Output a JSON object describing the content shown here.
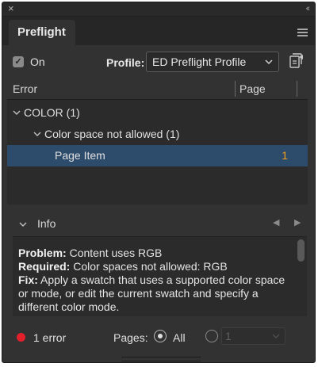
{
  "titlebar": {
    "close_icon": "×",
    "collapse_icon": "‹‹"
  },
  "tab": {
    "label": "Preflight"
  },
  "controls": {
    "on_label": "On",
    "on_checked": true,
    "profile_label": "Profile:",
    "profile_value": "ED Preflight Profile"
  },
  "columns": {
    "error": "Error",
    "page": "Page"
  },
  "tree": {
    "group": {
      "label": "COLOR (1)"
    },
    "subgroup": {
      "label": "Color space not allowed (1)"
    },
    "item": {
      "label": "Page Item",
      "page": "1"
    }
  },
  "info": {
    "label": "Info",
    "problem_label": "Problem:",
    "problem_text": " Content uses RGB",
    "required_label": "Required:",
    "required_text": " Color spaces not allowed: RGB",
    "fix_label": "Fix:",
    "fix_text": " Apply a swatch that uses a supported color space or mode, or edit the current swatch and specify a different color mode."
  },
  "footer": {
    "error_count": "1 error",
    "pages_label": "Pages:",
    "all_label": "All",
    "all_selected": true,
    "range_value": "1"
  },
  "colors": {
    "selection": "#2d4b6b",
    "page_number": "#f29c1c",
    "error_dot": "#e2202b"
  }
}
